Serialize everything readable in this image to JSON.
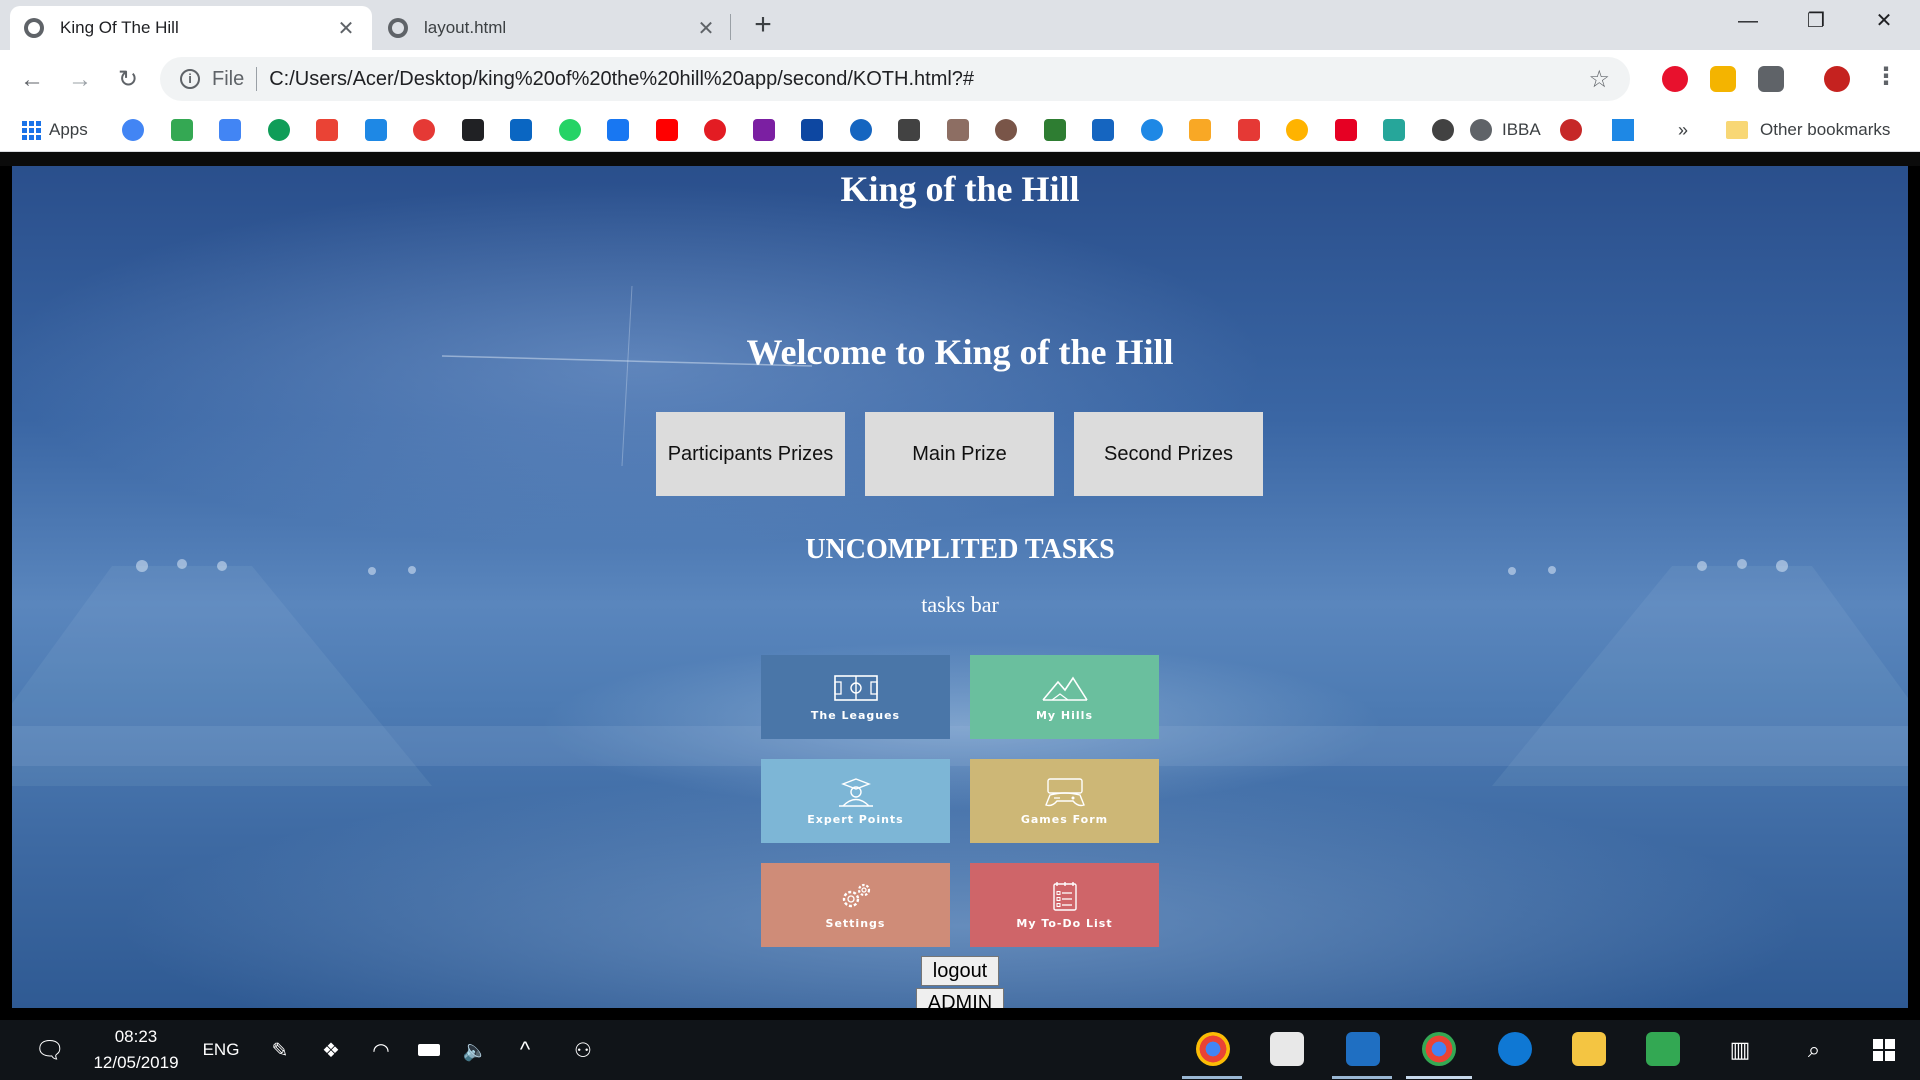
{
  "browser": {
    "tabs": [
      {
        "title": "King Of The Hill",
        "active": true
      },
      {
        "title": "layout.html",
        "active": false
      }
    ],
    "new_tab": "+",
    "window_controls": {
      "minimize": "—",
      "restore": "❐",
      "close": "✕"
    },
    "omnibox": {
      "scheme_label": "File",
      "url": "C:/Users/Acer/Desktop/king%20of%20the%20hill%20app/second/KOTH.html?#"
    },
    "bookmarks": {
      "apps_label": "Apps",
      "named_items": [
        {
          "label": "IBBA"
        }
      ],
      "overflow": "»",
      "other": "Other bookmarks"
    }
  },
  "page": {
    "site_title": "King of the Hill",
    "welcome_heading": "Welcome to King of the Hill",
    "prize_buttons": [
      {
        "label": "Participants Prizes"
      },
      {
        "label": "Main Prize"
      },
      {
        "label": "Second Prizes"
      }
    ],
    "tasks_heading": "UNCOMPLITED TASKS",
    "tasks_bar_text": "tasks bar",
    "tiles": [
      {
        "label": "The Leagues",
        "color": "#4a76a8",
        "icon": "field-icon"
      },
      {
        "label": "My Hills",
        "color": "#6abf9e",
        "icon": "mountain-icon"
      },
      {
        "label": "Expert Points",
        "color": "#7db6d6",
        "icon": "expert-icon"
      },
      {
        "label": "Games Form",
        "color": "#cdb776",
        "icon": "gamepad-icon"
      },
      {
        "label": "Settings",
        "color": "#cf8c78",
        "icon": "gears-icon"
      },
      {
        "label": "My To-Do List",
        "color": "#cf6569",
        "icon": "checklist-icon"
      }
    ],
    "logout_label": "logout",
    "admin_label": "ADMIN"
  },
  "taskbar": {
    "time": "08:23",
    "date": "12/05/2019",
    "language": "ENG"
  }
}
